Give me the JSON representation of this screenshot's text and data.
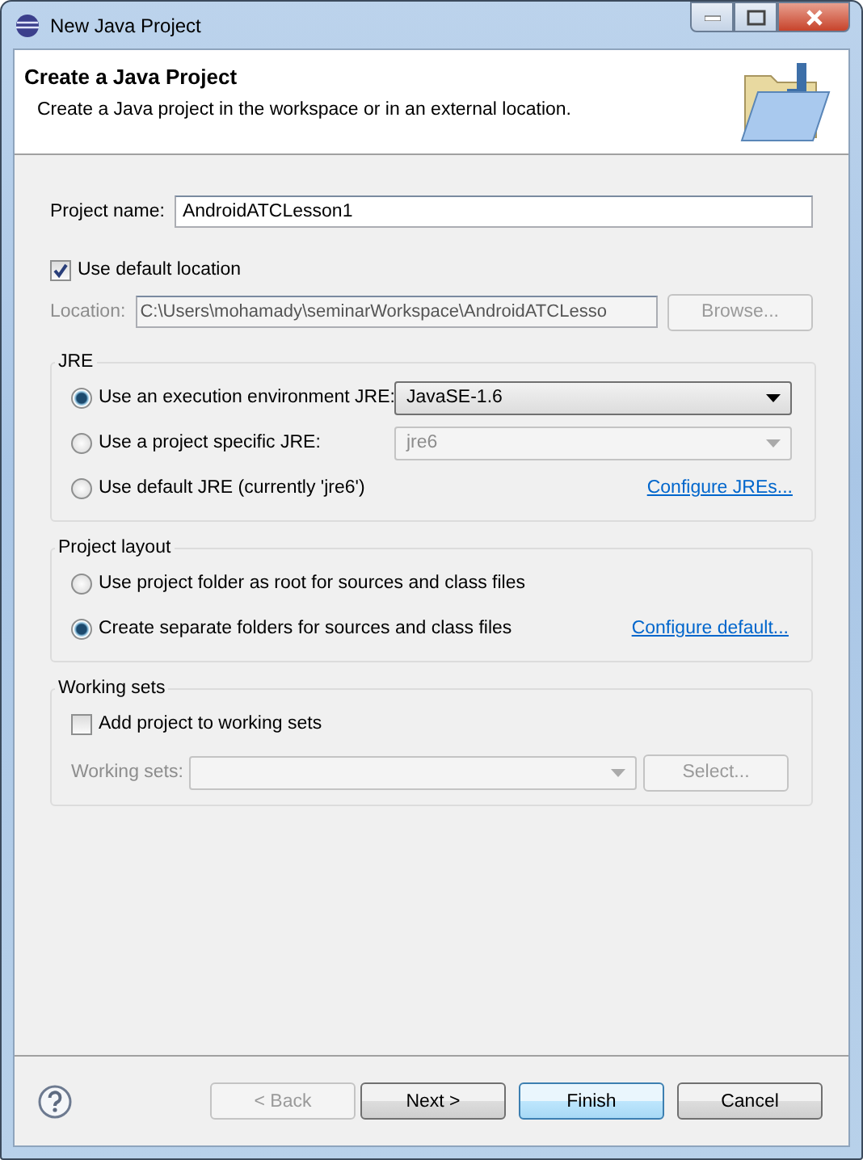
{
  "window": {
    "title": "New Java Project"
  },
  "header": {
    "title": "Create a Java Project",
    "description": "Create a Java project in the workspace or in an external location."
  },
  "project_name": {
    "label": "Project name:",
    "value": "AndroidATCLesson1"
  },
  "default_location": {
    "label": "Use default location",
    "checked": true
  },
  "location": {
    "label": "Location:",
    "value": "C:\\Users\\mohamady\\seminarWorkspace\\AndroidATCLesso",
    "disabled": true,
    "button": "Browse..."
  },
  "jre": {
    "title": "JRE",
    "options": [
      {
        "label": "Use an execution environment JRE:",
        "selected": true,
        "kind": "combo",
        "value": "JavaSE-1.6"
      },
      {
        "label": "Use a project specific JRE:",
        "selected": false,
        "kind": "combo",
        "value": "jre6"
      },
      {
        "label": "Use default JRE (currently 'jre6')",
        "selected": false,
        "kind": "link",
        "link": "Configure JREs..."
      }
    ]
  },
  "project_layout": {
    "title": "Project layout",
    "options": [
      {
        "label": "Use project folder as root for sources and class files",
        "selected": false,
        "kind": "plain"
      },
      {
        "label": "Create separate folders for sources and class files",
        "selected": true,
        "kind": "link",
        "link": "Configure default..."
      }
    ]
  },
  "working_sets": {
    "title": "Working sets",
    "checkbox": {
      "label": "Add project to working sets",
      "checked": false
    },
    "field_label": "Working sets:",
    "disabled": true,
    "button": "Select..."
  },
  "buttons": [
    {
      "label": "< Back",
      "disabled": true,
      "default": false
    },
    {
      "label": "Next >",
      "disabled": false,
      "default": false
    },
    {
      "label": "Finish",
      "disabled": false,
      "default": true
    },
    {
      "label": "Cancel",
      "disabled": false,
      "default": false
    }
  ]
}
